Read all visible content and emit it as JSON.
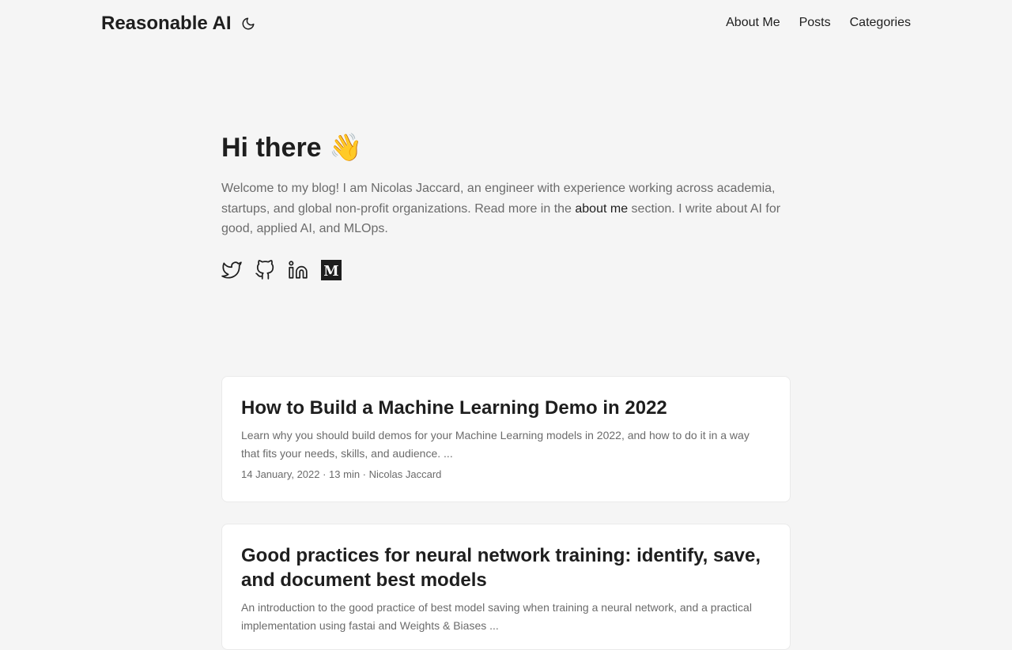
{
  "header": {
    "logo": "Reasonable AI",
    "theme_toggle_icon": "moon-icon",
    "nav": [
      {
        "label": "About Me"
      },
      {
        "label": "Posts"
      },
      {
        "label": "Categories"
      }
    ]
  },
  "hero": {
    "title": "Hi there 👋",
    "intro_before": "Welcome to my blog! I am Nicolas Jaccard, an engineer with experience working across academia, startups, and global non-profit organizations. Read more in the ",
    "intro_link": "about me",
    "intro_after": " section. I write about AI for good, applied AI, and MLOps.",
    "socials": [
      {
        "icon": "twitter-icon"
      },
      {
        "icon": "github-icon"
      },
      {
        "icon": "linkedin-icon"
      },
      {
        "icon": "medium-icon"
      }
    ]
  },
  "posts": [
    {
      "title": "How to Build a Machine Learning Demo in 2022",
      "summary": "Learn why you should build demos for your Machine Learning models in 2022, and how to do it in a way that fits your needs, skills, and audience. ...",
      "meta": "14 January, 2022 · 13 min · Nicolas Jaccard"
    },
    {
      "title": "Good practices for neural network training: identify, save, and document best models",
      "summary": "An introduction to the good practice of best model saving when training a neural network, and a practical implementation using fastai and Weights & Biases ...",
      "meta": ""
    }
  ]
}
